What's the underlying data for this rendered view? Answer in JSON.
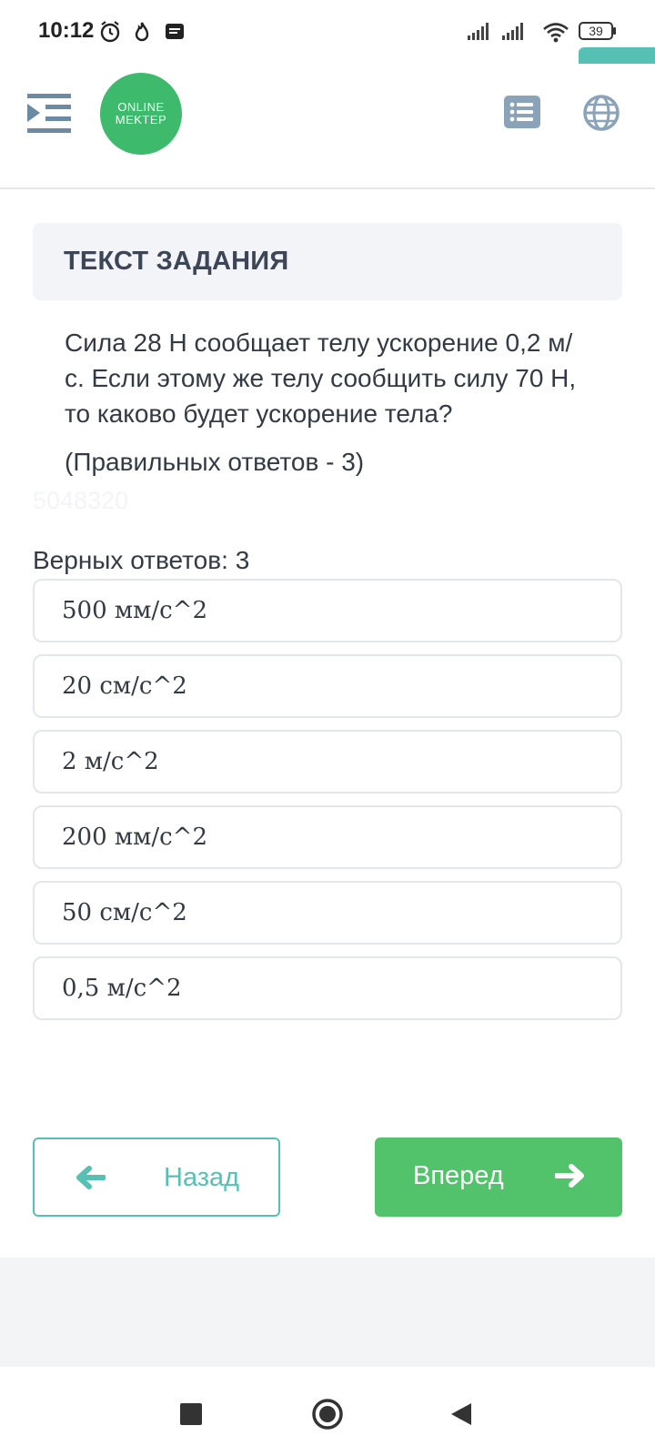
{
  "status_bar": {
    "time": "10:12",
    "battery": "39",
    "icons": [
      "alarm-icon",
      "flame-icon",
      "message-icon",
      "signal-icon",
      "signal-icon",
      "wifi-icon",
      "battery-icon"
    ]
  },
  "header": {
    "logo_line1": "ONLINE",
    "logo_line2": "MEKTEP",
    "accent_color": "#3dba6b",
    "icons": [
      "menu-icon",
      "list-icon",
      "globe-icon"
    ]
  },
  "task": {
    "title": "ТЕКСТ ЗАДАНИЯ",
    "question": "Сила 28 Н сообщает телу ускорение 0,2 м/с. Если этому же телу сообщить силу 70 Н, то каково будет ускорение тела?",
    "hint": "(Правильных ответов - 3)",
    "watermark": "5048320"
  },
  "answers": {
    "label": "Верных ответов: 3",
    "options": [
      "500 мм/с^2",
      "20 см/с^2",
      "2 м/с^2",
      "200 мм/с^2",
      "50 см/с^2",
      "0,5 м/с^2"
    ]
  },
  "navigation": {
    "back_label": "Назад",
    "next_label": "Вперед",
    "back_color": "#56c0b4",
    "next_color": "#52c26b"
  }
}
